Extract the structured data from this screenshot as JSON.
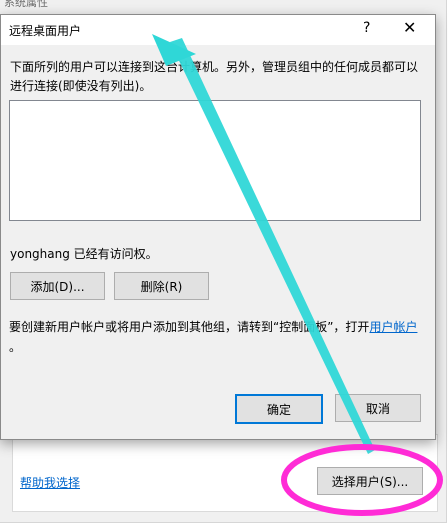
{
  "background_window": {
    "title_partial": "系统属性",
    "help_link": "帮助我选择",
    "select_users_button": "选择用户(S)..."
  },
  "dialog": {
    "title": "远程桌面用户",
    "help_glyph": "?",
    "close_glyph": "✕",
    "description": "下面所列的用户可以连接到这台计算机。另外，管理员组中的任何成员都可以进行连接(即使没有列出)。",
    "user_list_items": [],
    "access_text": "yonghang 已经有访问权。",
    "add_button": "添加(D)...",
    "remove_button": "删除(R)",
    "info_prefix": "要创建新用户帐户或将用户添加到其他组，请转到“控制面板”，打开",
    "info_link": "用户帐户",
    "info_suffix": "。",
    "ok_button": "确定",
    "cancel_button": "取消"
  },
  "annotations": {
    "arrow_color": "#2fd7d7",
    "circle_color": "#ff2bd6"
  }
}
